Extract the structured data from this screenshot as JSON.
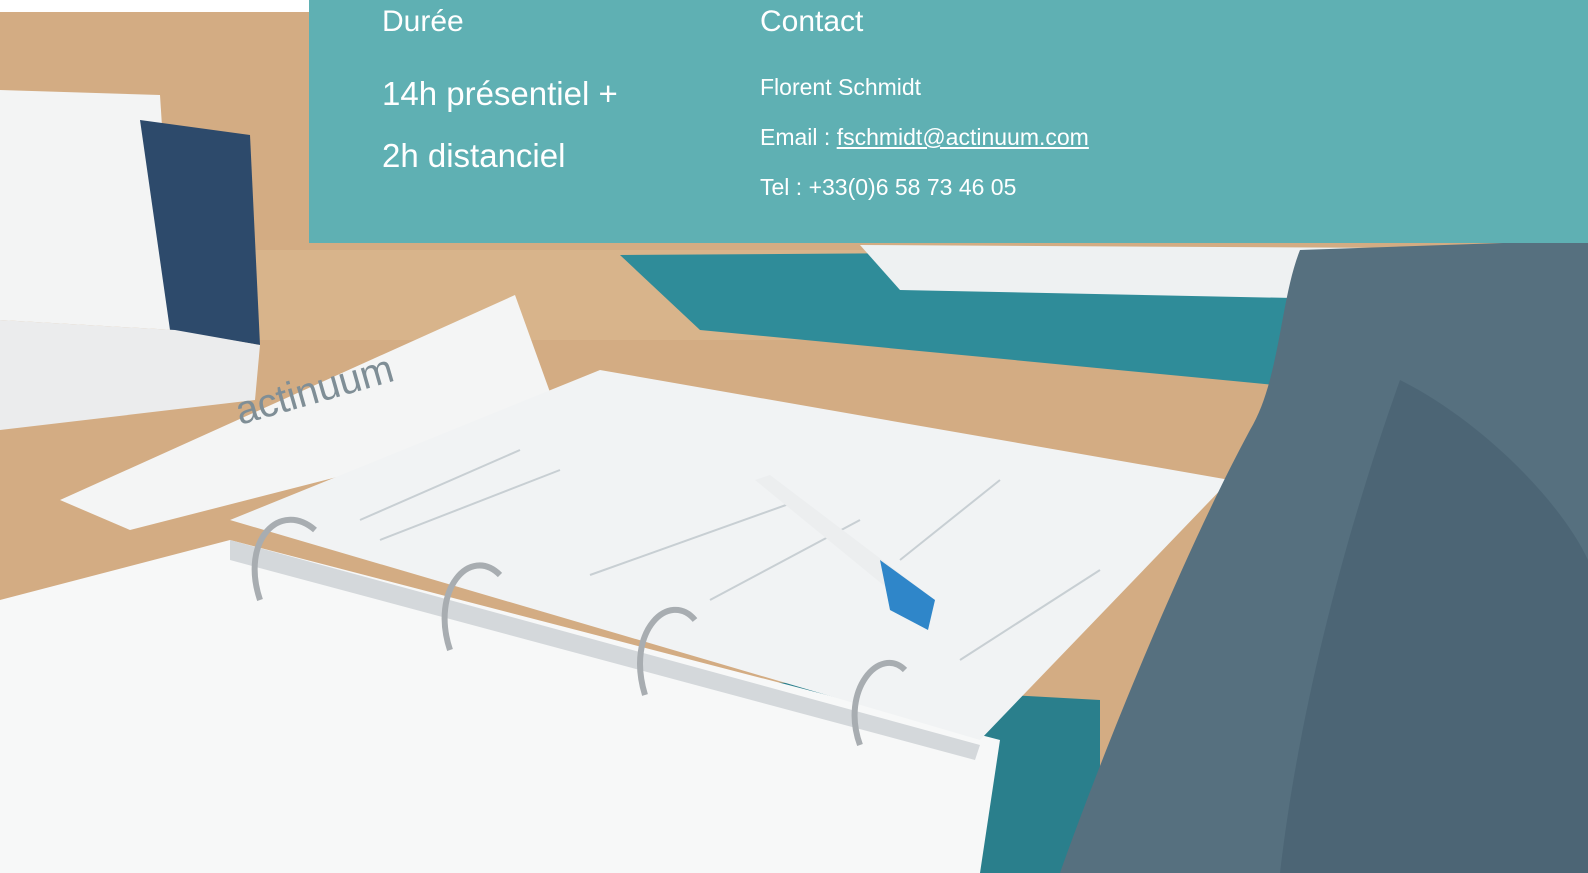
{
  "duration": {
    "heading": "Durée",
    "lines": [
      "14h présentiel +",
      "2h distanciel"
    ]
  },
  "contact": {
    "heading": "Contact",
    "name": "Florent Schmidt",
    "email_label": "Email : ",
    "email": "fschmidt@actinuum.com",
    "phone": "Tel : +33(0)6 58 73 46 05"
  },
  "photo": {
    "tent_card_text": "actinuum"
  },
  "colors": {
    "panel": "#5fb0b3",
    "text": "#ffffff"
  }
}
